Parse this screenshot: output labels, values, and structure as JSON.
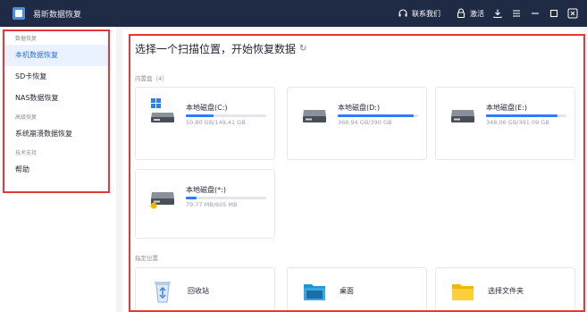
{
  "titlebar": {
    "app_title": "易昕数据恢复",
    "contact_label": "联系我们",
    "activate_label": "激活",
    "icons": [
      "headset-icon",
      "lock-icon",
      "download-icon",
      "menu-icon",
      "minimize-icon",
      "maximize-icon",
      "close-icon"
    ]
  },
  "sidebar": {
    "groups": [
      {
        "label": "数据恢复",
        "items": [
          "本机数据恢复",
          "SD卡恢复",
          "NAS数据恢复"
        ]
      },
      {
        "label": "高级恢复",
        "items": [
          "系统崩溃数据恢复"
        ]
      },
      {
        "label": "技术支持",
        "items": [
          "帮助"
        ]
      }
    ],
    "active_item": "本机数据恢复"
  },
  "main": {
    "title": "选择一个扫描位置，开始恢复数据",
    "internal_label": "内置盘（4）",
    "drives": [
      {
        "name": "本地磁盘(C:)",
        "size": "50.80 GB/149.41 GB",
        "used_fraction": 0.34,
        "icon": "windows-drive-icon"
      },
      {
        "name": "本地磁盘(D:)",
        "size": "366.94 GB/390 GB",
        "used_fraction": 0.94,
        "icon": "drive-icon"
      },
      {
        "name": "本地磁盘(E:)",
        "size": "348.06 GB/391.09 GB",
        "used_fraction": 0.89,
        "icon": "drive-icon"
      },
      {
        "name": "本地磁盘(*:)",
        "size": "79.77 MB/605 MB",
        "used_fraction": 0.13,
        "icon": "drive-warning-icon"
      }
    ],
    "location_label": "指定位置",
    "locations": [
      {
        "label": "回收站",
        "icon": "recycle-bin-icon"
      },
      {
        "label": "桌面",
        "icon": "desktop-folder-icon"
      },
      {
        "label": "选择文件夹",
        "icon": "folder-icon"
      }
    ]
  },
  "colors": {
    "titlebar": "#1f2a44",
    "accent": "#2f7df6",
    "highlight_border": "#e53935",
    "active_bg": "#eaf2ff"
  }
}
